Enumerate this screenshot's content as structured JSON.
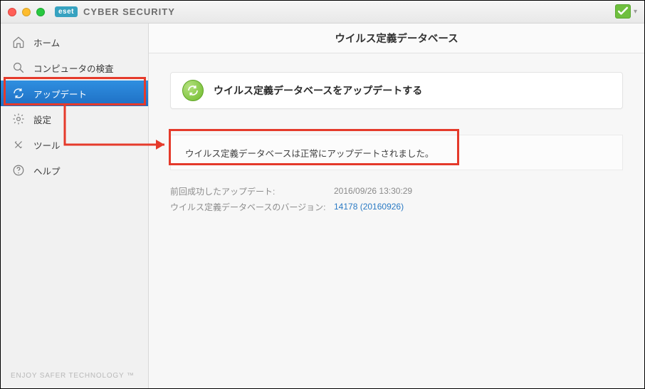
{
  "titlebar": {
    "brand_badge": "eset",
    "brand_title": "CYBER SECURITY"
  },
  "sidebar": {
    "items": [
      {
        "label": "ホーム"
      },
      {
        "label": "コンピュータの検査"
      },
      {
        "label": "アップデート"
      },
      {
        "label": "設定"
      },
      {
        "label": "ツール"
      },
      {
        "label": "ヘルプ"
      }
    ],
    "footer": "ENJOY SAFER TECHNOLOGY ™"
  },
  "main": {
    "header": "ウイルス定義データベース",
    "update_card": "ウイルス定義データベースをアップデートする",
    "message": "ウイルス定義データベースは正常にアップデートされました。",
    "last_success_label": "前回成功したアップデート:",
    "last_success_value": "2016/09/26 13:30:29",
    "db_version_label": "ウイルス定義データベースのバージョン:",
    "db_version_value": "14178 (20160926)"
  }
}
